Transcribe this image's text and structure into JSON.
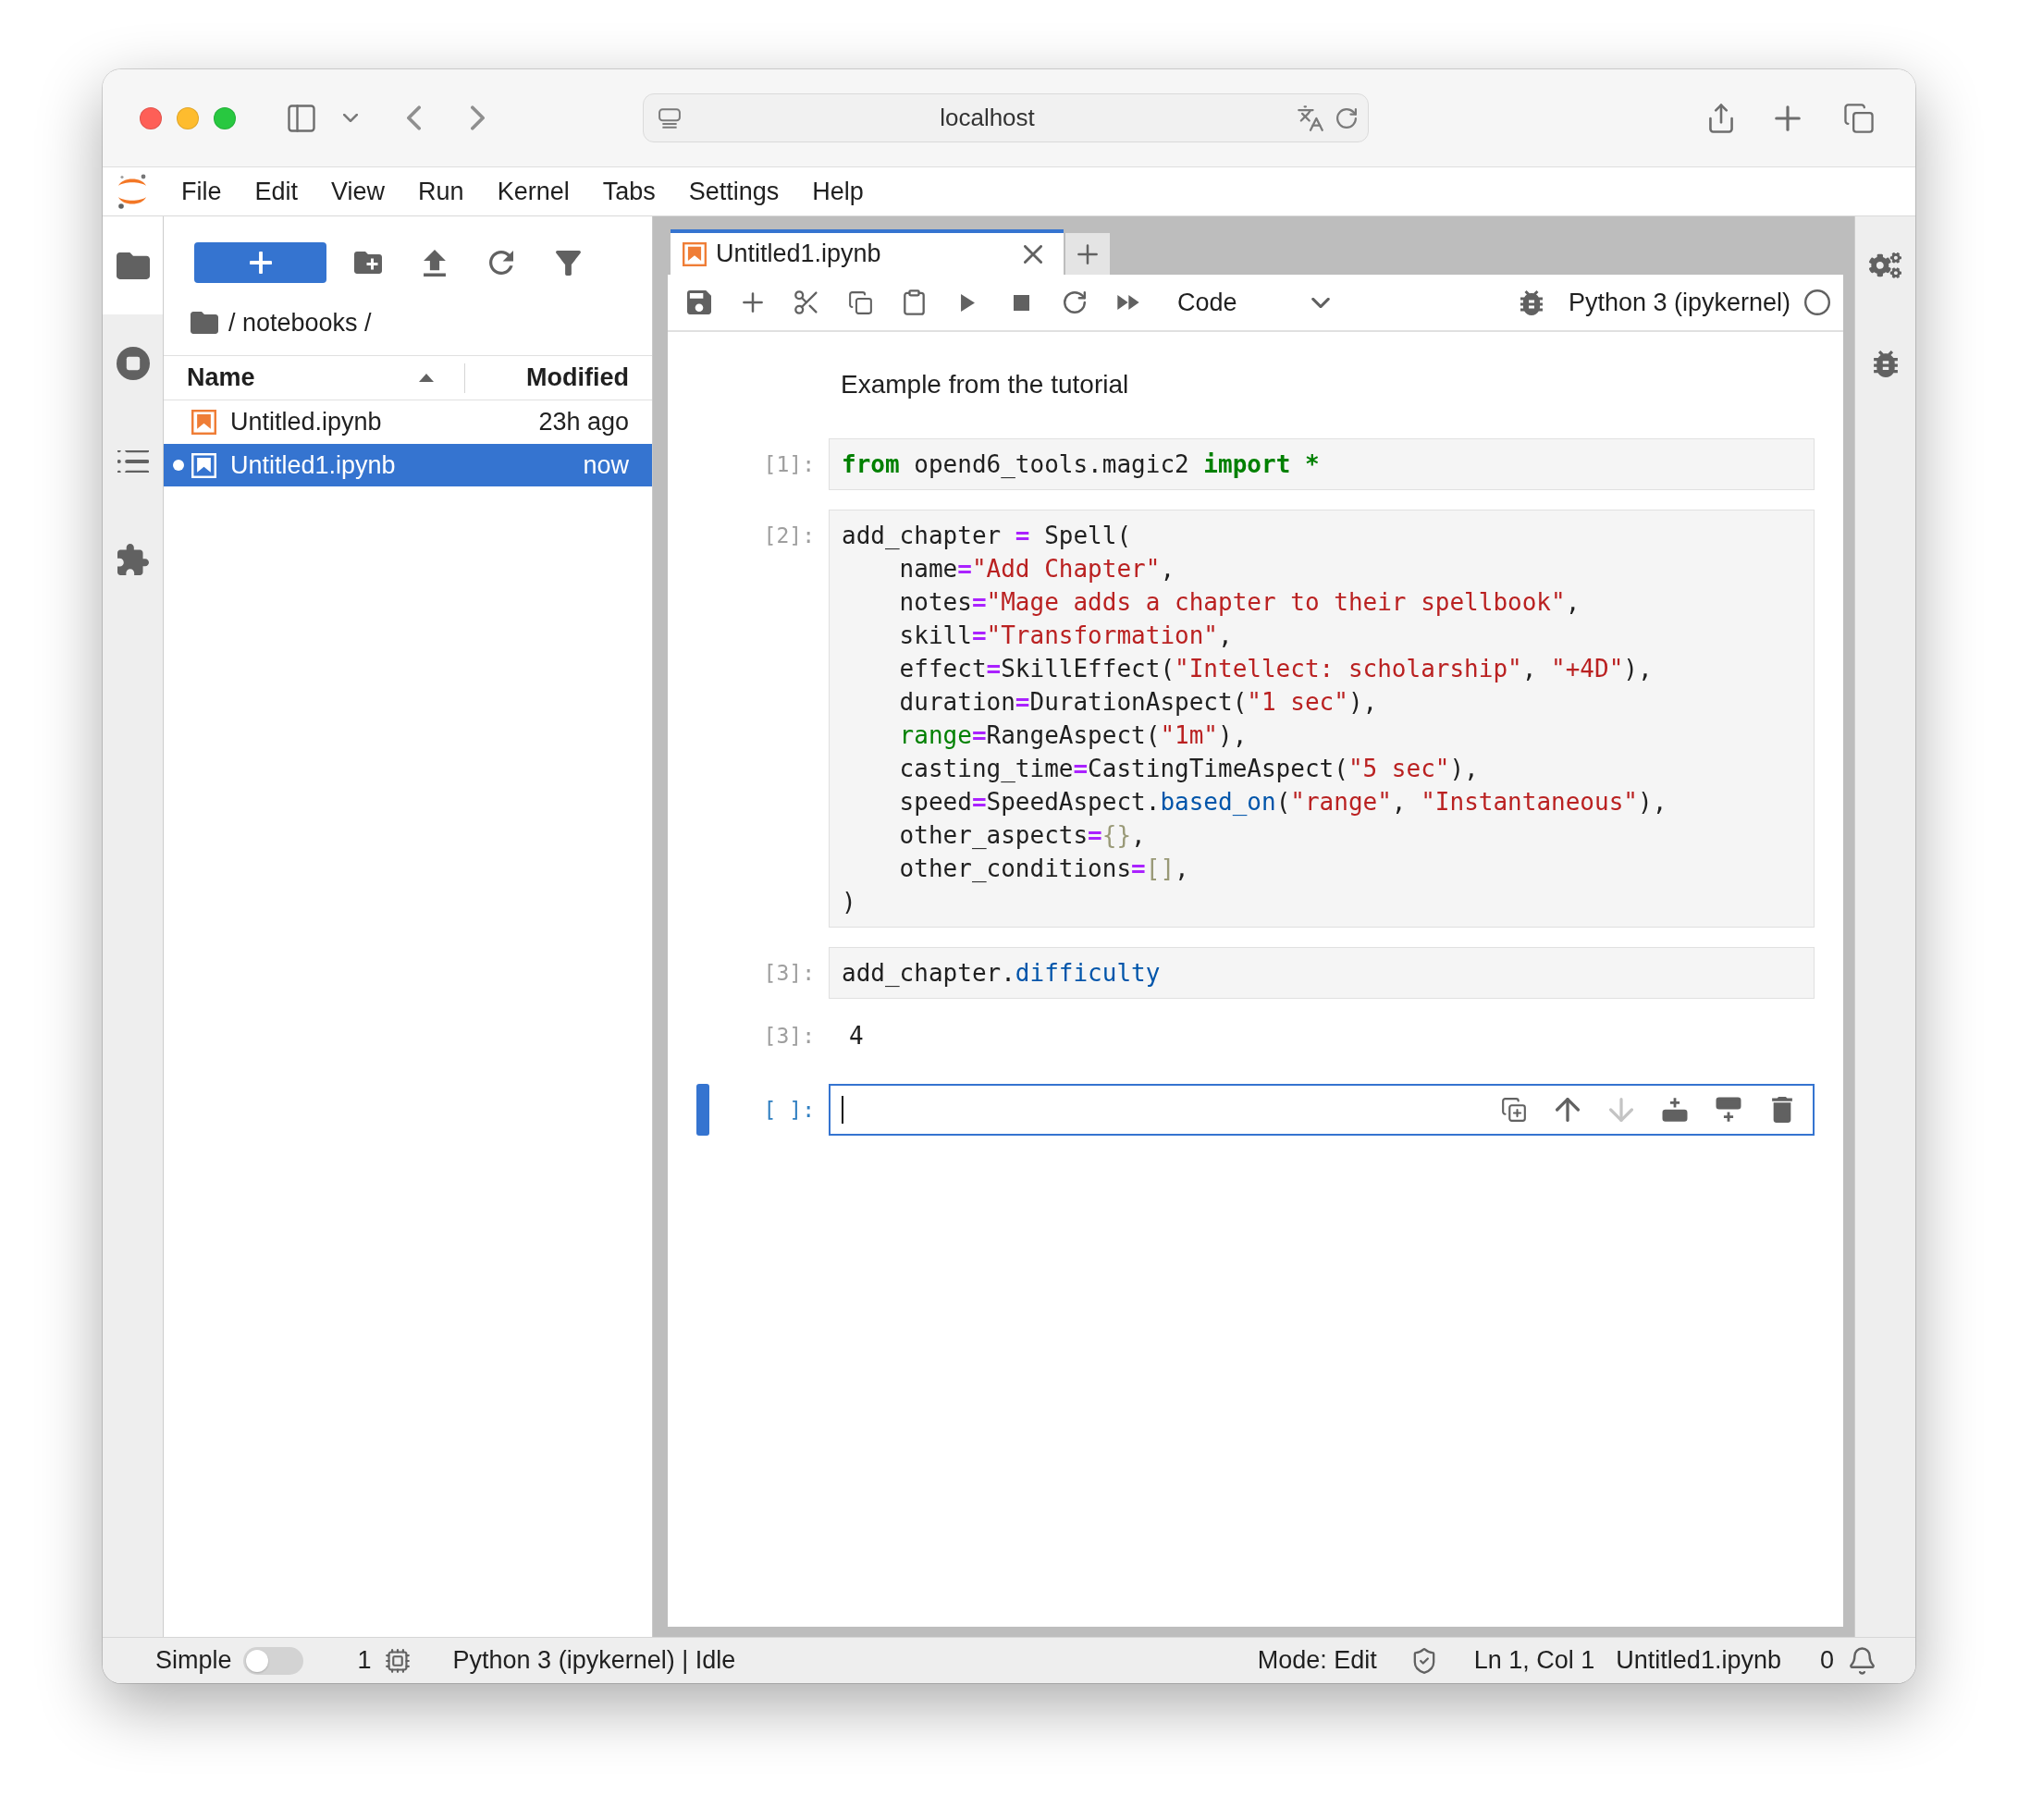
{
  "browser": {
    "url": "localhost"
  },
  "menu": [
    "File",
    "Edit",
    "View",
    "Run",
    "Kernel",
    "Tabs",
    "Settings",
    "Help"
  ],
  "left_sidebar": {
    "tabs": [
      {
        "selected": true
      },
      {
        "selected": false
      },
      {
        "selected": false
      },
      {
        "selected": false
      }
    ]
  },
  "file_browser": {
    "path": "/ notebooks /",
    "columns": [
      {
        "label": "Name",
        "sorted": true
      },
      {
        "label": "Modified",
        "sorted": false
      }
    ],
    "files": [
      {
        "name": "Untitled.ipynb",
        "modified": "23h ago",
        "selected": false,
        "running": false
      },
      {
        "name": "Untitled1.ipynb",
        "modified": "now",
        "selected": true,
        "running": true
      }
    ]
  },
  "notebook": {
    "tabs": [
      {
        "label": "Untitled1.ipynb",
        "selected": true
      }
    ],
    "cell_type": "Code",
    "kernel": "Python 3 (ipykernel)",
    "kernel_busy": false,
    "cells": [
      {
        "kind": "markdown",
        "text": "Example from the tutorial"
      },
      {
        "kind": "code",
        "prompt": "[1]:",
        "active": false,
        "lines": [
          [
            {
              "text": "from",
              "kind": "keyword"
            },
            {
              "text": " opend6_tools.magic2 ",
              "kind": "plain"
            },
            {
              "text": "import *",
              "kind": "keyword"
            }
          ]
        ]
      },
      {
        "kind": "code",
        "prompt": "[2]:",
        "active": false,
        "lines": [
          [
            {
              "text": "add_chapter ",
              "kind": "plain"
            },
            {
              "text": "=",
              "kind": "operator"
            },
            {
              "text": " Spell(",
              "kind": "plain"
            }
          ],
          [
            {
              "text": "    name",
              "kind": "plain"
            },
            {
              "text": "=",
              "kind": "operator"
            },
            {
              "text": "\"Add Chapter\"",
              "kind": "string"
            },
            {
              "text": ",",
              "kind": "plain"
            }
          ],
          [
            {
              "text": "    notes",
              "kind": "plain"
            },
            {
              "text": "=",
              "kind": "operator"
            },
            {
              "text": "\"Mage adds a chapter to their spellbook\"",
              "kind": "string"
            },
            {
              "text": ",",
              "kind": "plain"
            }
          ],
          [
            {
              "text": "    skill",
              "kind": "plain"
            },
            {
              "text": "=",
              "kind": "operator"
            },
            {
              "text": "\"Transformation\"",
              "kind": "string"
            },
            {
              "text": ",",
              "kind": "plain"
            }
          ],
          [
            {
              "text": "    effect",
              "kind": "plain"
            },
            {
              "text": "=",
              "kind": "operator"
            },
            {
              "text": "SkillEffect(",
              "kind": "plain"
            },
            {
              "text": "\"Intellect: scholarship\"",
              "kind": "string"
            },
            {
              "text": ", ",
              "kind": "plain"
            },
            {
              "text": "\"+4D\"",
              "kind": "string"
            },
            {
              "text": "),",
              "kind": "plain"
            }
          ],
          [
            {
              "text": "    duration",
              "kind": "plain"
            },
            {
              "text": "=",
              "kind": "operator"
            },
            {
              "text": "DurationAspect(",
              "kind": "plain"
            },
            {
              "text": "\"1 sec\"",
              "kind": "string"
            },
            {
              "text": "),",
              "kind": "plain"
            }
          ],
          [
            {
              "text": "    range",
              "kind": "builtin"
            },
            {
              "text": "=",
              "kind": "operator"
            },
            {
              "text": "RangeAspect(",
              "kind": "plain"
            },
            {
              "text": "\"1m\"",
              "kind": "string"
            },
            {
              "text": "),",
              "kind": "plain"
            }
          ],
          [
            {
              "text": "    casting_time",
              "kind": "plain"
            },
            {
              "text": "=",
              "kind": "operator"
            },
            {
              "text": "CastingTimeAspect(",
              "kind": "plain"
            },
            {
              "text": "\"5 sec\"",
              "kind": "string"
            },
            {
              "text": "),",
              "kind": "plain"
            }
          ],
          [
            {
              "text": "    speed",
              "kind": "plain"
            },
            {
              "text": "=",
              "kind": "operator"
            },
            {
              "text": "SpeedAspect.",
              "kind": "plain"
            },
            {
              "text": "based_on",
              "kind": "property"
            },
            {
              "text": "(",
              "kind": "plain"
            },
            {
              "text": "\"range\"",
              "kind": "string"
            },
            {
              "text": ", ",
              "kind": "plain"
            },
            {
              "text": "\"Instantaneous\"",
              "kind": "string"
            },
            {
              "text": "),",
              "kind": "plain"
            }
          ],
          [
            {
              "text": "    other_aspects",
              "kind": "plain"
            },
            {
              "text": "=",
              "kind": "operator"
            },
            {
              "text": "{}",
              "kind": "bracket"
            },
            {
              "text": ",",
              "kind": "plain"
            }
          ],
          [
            {
              "text": "    other_conditions",
              "kind": "plain"
            },
            {
              "text": "=",
              "kind": "operator"
            },
            {
              "text": "[]",
              "kind": "bracket"
            },
            {
              "text": ",",
              "kind": "plain"
            }
          ],
          [
            {
              "text": ")",
              "kind": "plain"
            }
          ]
        ]
      },
      {
        "kind": "code",
        "prompt": "[3]:",
        "active": false,
        "lines": [
          [
            {
              "text": "add_chapter.",
              "kind": "plain"
            },
            {
              "text": "difficulty",
              "kind": "property"
            }
          ]
        ],
        "output": {
          "prompt": "[3]:",
          "text": "4"
        }
      },
      {
        "kind": "code",
        "prompt": "[ ]:",
        "active": true,
        "toolbar": [
          {
            "disabled": false
          },
          {
            "disabled": false
          },
          {
            "disabled": true
          },
          {
            "disabled": false
          },
          {
            "disabled": false
          },
          {
            "disabled": false
          }
        ]
      }
    ]
  },
  "right_sidebar": {
    "tabs": [
      {
        "selected": false
      },
      {
        "selected": false
      }
    ]
  },
  "status_bar": {
    "simple_mode": {
      "label": "Simple",
      "on": false
    },
    "running": "1",
    "kernel_status": "Python 3 (ipykernel) | Idle",
    "mode": "Mode: Edit",
    "cursor": "Ln 1, Col 1",
    "file": "Untitled1.ipynb",
    "notifications": "0"
  }
}
